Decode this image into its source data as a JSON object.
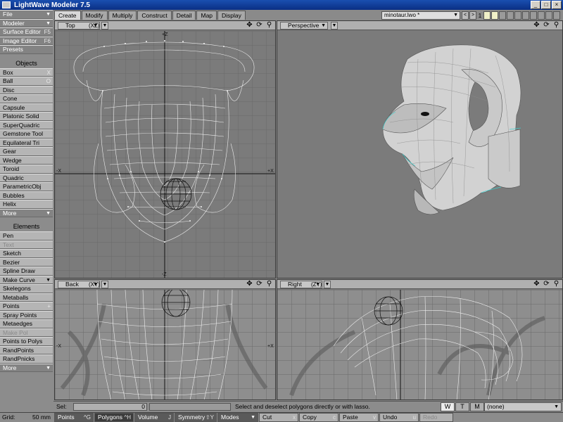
{
  "window": {
    "title": "LightWave Modeler 7.5",
    "minimize": "_",
    "maximize": "□",
    "close": "×"
  },
  "left_toolbar": {
    "top": [
      {
        "label": "File",
        "dark": true,
        "arrow": "▼"
      },
      {
        "label": "Modeler",
        "dark": true,
        "arrow": "▼"
      },
      {
        "label": "Surface Editor",
        "shortcut": "F5",
        "dark": true
      },
      {
        "label": "Image Editor",
        "shortcut": "F6",
        "dark": true
      },
      {
        "label": "Presets",
        "dark": true
      }
    ],
    "objects_header": "Objects",
    "objects": [
      {
        "label": "Box",
        "shortcut": "X"
      },
      {
        "label": "Ball",
        "shortcut": "O"
      },
      {
        "label": "Disc"
      },
      {
        "label": "Cone"
      },
      {
        "label": "Capsule"
      },
      {
        "label": "Platonic Solid"
      },
      {
        "label": "SuperQuadric"
      },
      {
        "label": "Gemstone Tool"
      },
      {
        "label": "Equilateral Tri"
      },
      {
        "label": "Gear"
      },
      {
        "label": "Wedge"
      },
      {
        "label": "Toroid"
      },
      {
        "label": "Quadric"
      },
      {
        "label": "ParametricObj"
      },
      {
        "label": "Bubbles"
      },
      {
        "label": "Helix"
      },
      {
        "label": "More",
        "dark": true,
        "arrow": "▼"
      }
    ],
    "elements_header": "Elements",
    "elements": [
      {
        "label": "Pen"
      },
      {
        "label": "Text",
        "dim": true
      },
      {
        "label": "Sketch"
      },
      {
        "label": "Bezier"
      },
      {
        "label": "Spline Draw"
      },
      {
        "label": "Make Curve",
        "arrow": "▼"
      },
      {
        "label": "Skelegons"
      },
      {
        "label": "Metaballs"
      },
      {
        "label": "Points",
        "shortcut": "+"
      },
      {
        "label": "Spray Points"
      },
      {
        "label": "Metaedges"
      },
      {
        "label": "Make Pol",
        "dim": true
      },
      {
        "label": "Points to Polys"
      },
      {
        "label": "RandPoints"
      },
      {
        "label": "RandPnicks"
      },
      {
        "label": "More",
        "dark": true,
        "arrow": "▼"
      }
    ]
  },
  "tabs": [
    {
      "label": "Create",
      "active": true
    },
    {
      "label": "Modify"
    },
    {
      "label": "Multiply"
    },
    {
      "label": "Construct"
    },
    {
      "label": "Detail"
    },
    {
      "label": "Map"
    },
    {
      "label": "Display"
    }
  ],
  "object_selector": {
    "value": "minotaur.lwo *",
    "arrow": "▼"
  },
  "layers": {
    "prev": "<",
    "next": ">",
    "current": "1"
  },
  "viewports": {
    "top": {
      "name": "Top",
      "axis": "(XZ)",
      "arrow": "▼",
      "view_arrow": "▼"
    },
    "perspective": {
      "name": "Perspective",
      "arrow": "▼",
      "view_arrow": "▼"
    },
    "back": {
      "name": "Back",
      "axis": "(XY)",
      "arrow": "▼",
      "view_arrow": "▼"
    },
    "right": {
      "name": "Right",
      "axis": "(ZY)",
      "arrow": "▼",
      "view_arrow": "▼"
    },
    "axis_marks": {
      "z_top": "+Z",
      "z_bottom": "-Z",
      "x_left": "-X",
      "x_right": "+X"
    }
  },
  "status": {
    "sel_label": "Sel:",
    "sel_count": "0",
    "help": "Select and deselect polygons directly or with lasso.",
    "modes": [
      "W",
      "T",
      "M"
    ],
    "active_mode": "W",
    "surface": "(none)"
  },
  "bottom_bar": {
    "grid_label": "Grid:",
    "grid_value": "50 mm",
    "buttons": [
      {
        "label": "Points",
        "shortcut": "^G"
      },
      {
        "label": "Polygons",
        "shortcut": "^H",
        "active": true
      },
      {
        "label": "Volume",
        "shortcut": "J"
      },
      {
        "label": "Symmetry",
        "shortcut": "⇧Y"
      },
      {
        "label": "Modes",
        "arrow": "▼"
      },
      {
        "label": "Cut",
        "shortcut": "x"
      },
      {
        "label": "Copy",
        "shortcut": "c"
      },
      {
        "label": "Paste",
        "shortcut": "v"
      },
      {
        "label": "Undo",
        "shortcut": "u"
      },
      {
        "label": "Redo",
        "dim": true
      }
    ]
  },
  "colors": {
    "accent_blue": "#0a2f84",
    "viewport_bg": "#7b7b7b",
    "wire": "#e8e8e8",
    "selected": "#111111"
  }
}
